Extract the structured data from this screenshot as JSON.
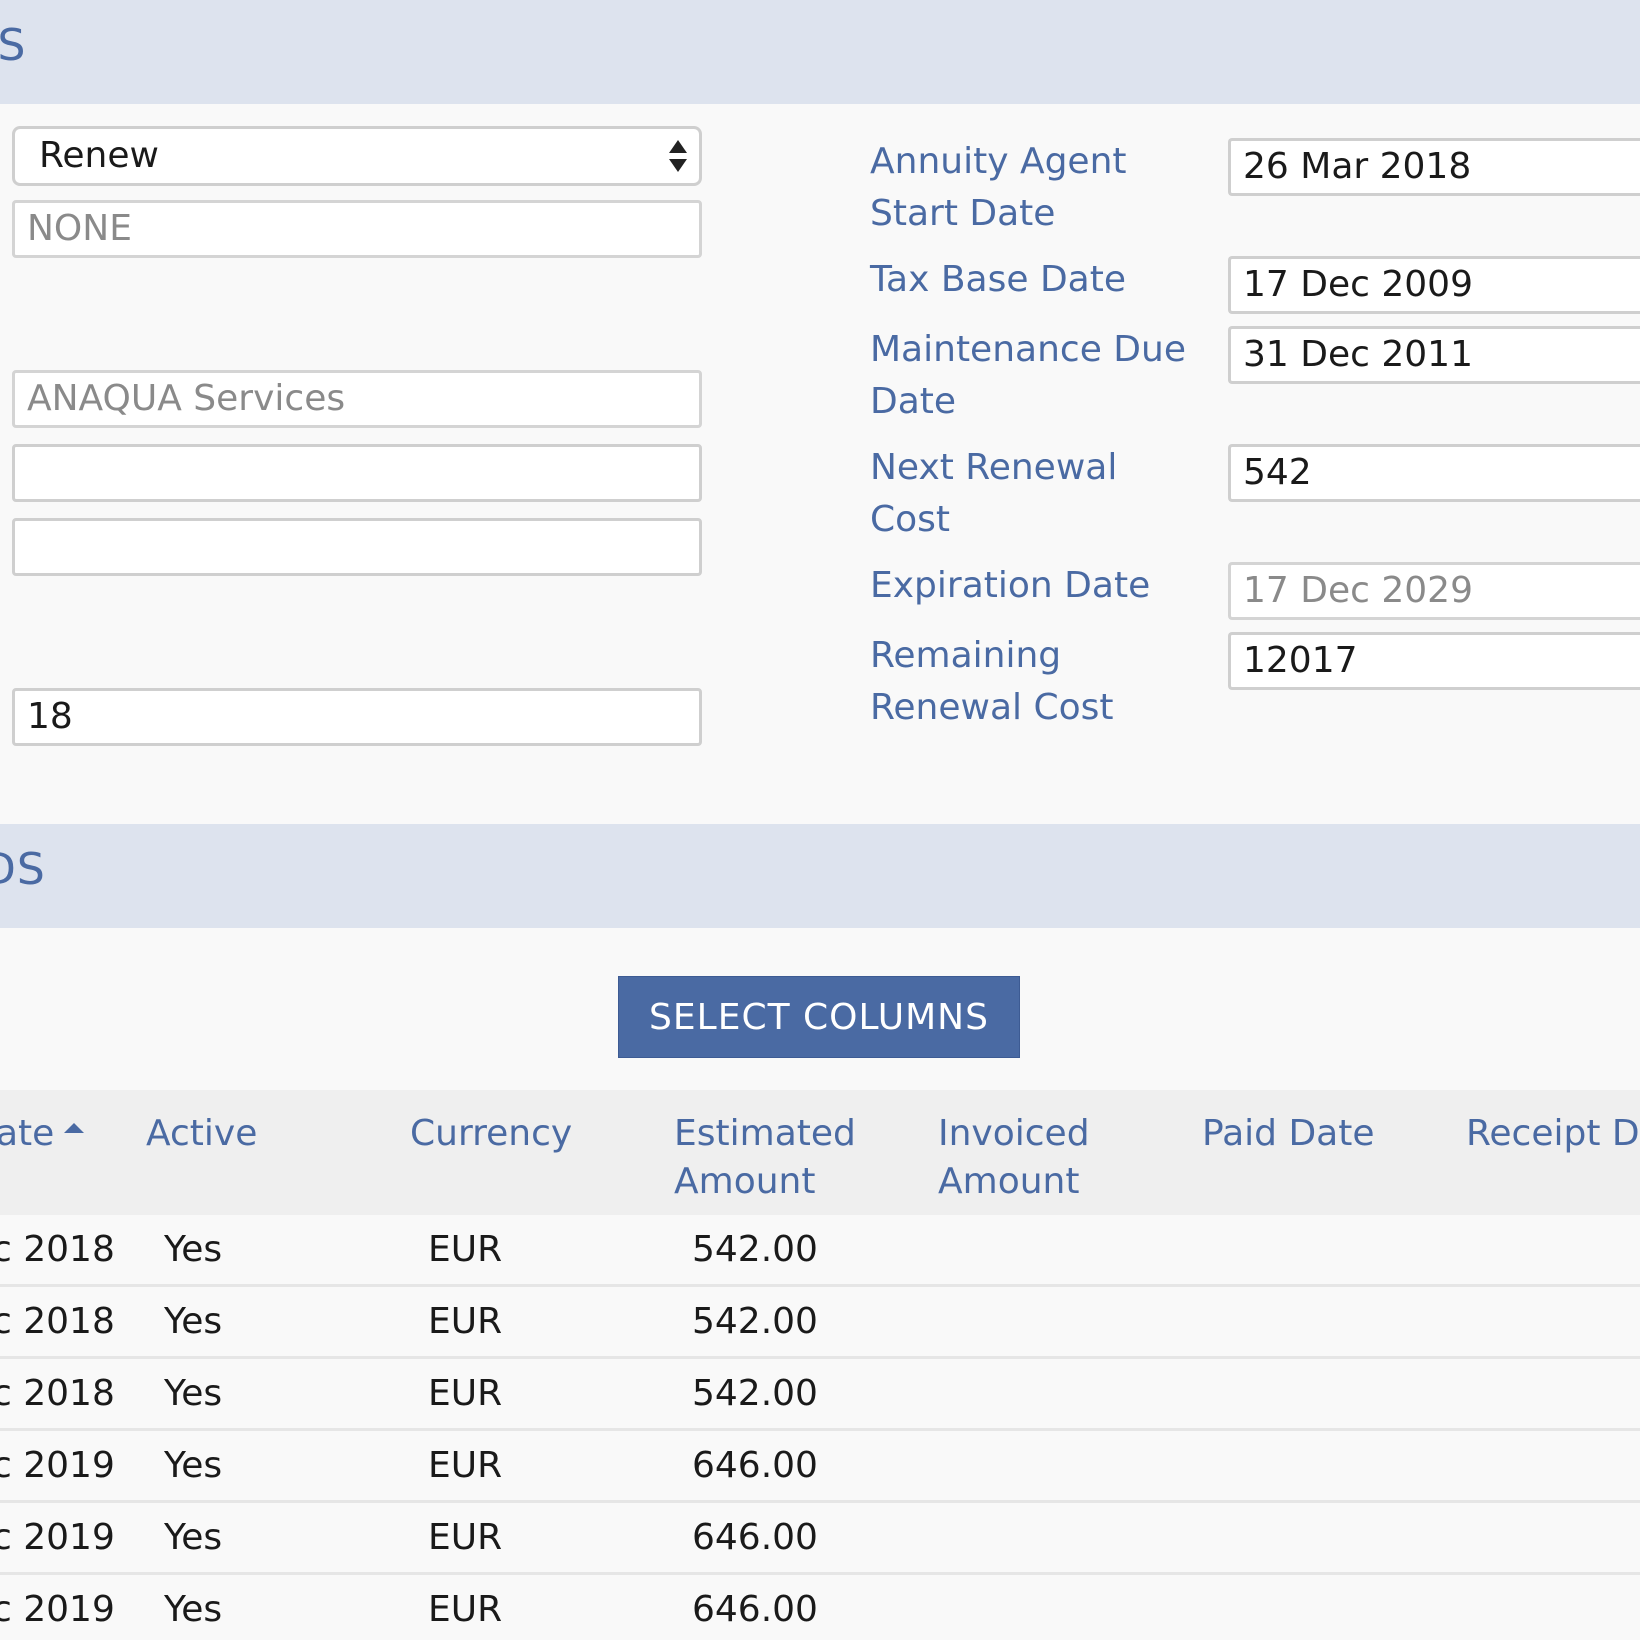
{
  "section1": {
    "title": "LS",
    "left_fields": {
      "select_value": "Renew",
      "field_2": "NONE",
      "field_3": "ANAQUA Services",
      "field_4": "",
      "field_5": "",
      "field_6": "18"
    },
    "right_fields": [
      {
        "label": "Annuity Agent Start Date",
        "value": "26 Mar 2018"
      },
      {
        "label": "Tax Base Date",
        "value": "17 Dec 2009"
      },
      {
        "label": "Maintenance Due Date",
        "value": "31 Dec 2011"
      },
      {
        "label": "Next Renewal Cost",
        "value": "542"
      },
      {
        "label": "Expiration Date",
        "value": "17 Dec 2029"
      },
      {
        "label": "Remaining Renewal Cost",
        "value": "12017"
      }
    ]
  },
  "section2": {
    "title": "DS",
    "select_columns_label": "SELECT COLUMNS",
    "columns": [
      "ate",
      "Active",
      "Currency",
      "Estimated Amount",
      "Invoiced Amount",
      "Paid Date",
      "Receipt Da"
    ],
    "rows": [
      [
        "c 2018",
        "Yes",
        "EUR",
        "542.00",
        "",
        "",
        ""
      ],
      [
        "c 2018",
        "Yes",
        "EUR",
        "542.00",
        "",
        "",
        ""
      ],
      [
        "c 2018",
        "Yes",
        "EUR",
        "542.00",
        "",
        "",
        ""
      ],
      [
        "c 2019",
        "Yes",
        "EUR",
        "646.00",
        "",
        "",
        ""
      ],
      [
        "c 2019",
        "Yes",
        "EUR",
        "646.00",
        "",
        "",
        ""
      ],
      [
        "c 2019",
        "Yes",
        "EUR",
        "646.00",
        "",
        "",
        ""
      ]
    ]
  },
  "colors": {
    "accent": "#4a6aa3",
    "header_bg": "#dde3ee",
    "table_header_bg": "#efefef"
  }
}
